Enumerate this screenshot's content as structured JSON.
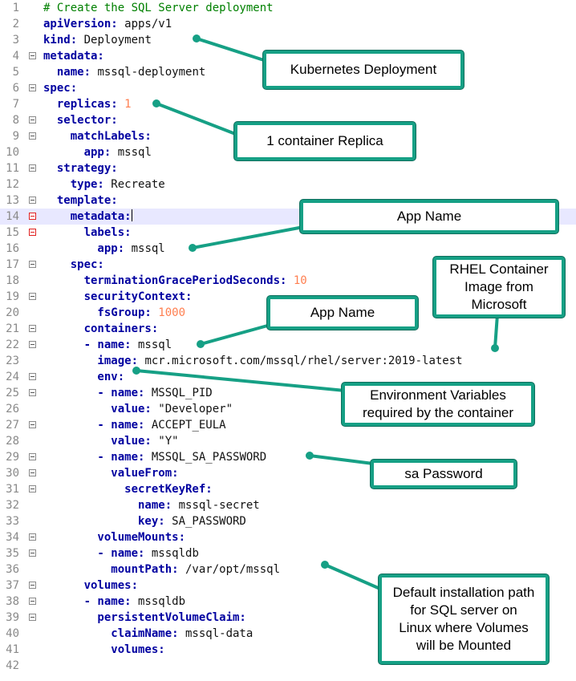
{
  "colors": {
    "keyword": "#0000a0",
    "number": "#ff7f50",
    "comment": "#008000",
    "callout_border": "#16a085"
  },
  "code_lines": [
    {
      "num": "1",
      "parts": [
        {
          "t": "# Create the SQL Server deployment",
          "c": "c"
        }
      ]
    },
    {
      "num": "2",
      "parts": [
        {
          "t": "apiVersion:",
          "c": "k"
        },
        {
          "t": " apps/v1",
          "c": "v"
        }
      ]
    },
    {
      "num": "3",
      "parts": [
        {
          "t": "kind:",
          "c": "k"
        },
        {
          "t": " Deployment",
          "c": "v"
        }
      ]
    },
    {
      "num": "4",
      "parts": [
        {
          "t": "metadata:",
          "c": "k"
        }
      ]
    },
    {
      "num": "5",
      "parts": [
        {
          "t": "  name:",
          "c": "k"
        },
        {
          "t": " mssql-deployment",
          "c": "v"
        }
      ]
    },
    {
      "num": "6",
      "parts": [
        {
          "t": "spec:",
          "c": "k"
        }
      ]
    },
    {
      "num": "7",
      "parts": [
        {
          "t": "  replicas:",
          "c": "k"
        },
        {
          "t": " ",
          "c": "v"
        },
        {
          "t": "1",
          "c": "n"
        }
      ]
    },
    {
      "num": "8",
      "parts": [
        {
          "t": "  selector:",
          "c": "k"
        }
      ]
    },
    {
      "num": "9",
      "parts": [
        {
          "t": "    matchLabels:",
          "c": "k"
        }
      ]
    },
    {
      "num": "10",
      "parts": [
        {
          "t": "      app:",
          "c": "k"
        },
        {
          "t": " mssql",
          "c": "v"
        }
      ]
    },
    {
      "num": "11",
      "parts": [
        {
          "t": "  strategy:",
          "c": "k"
        }
      ]
    },
    {
      "num": "12",
      "parts": [
        {
          "t": "    type:",
          "c": "k"
        },
        {
          "t": " Recreate",
          "c": "v"
        }
      ]
    },
    {
      "num": "13",
      "parts": [
        {
          "t": "  template:",
          "c": "k"
        }
      ]
    },
    {
      "num": "14",
      "parts": [
        {
          "t": "    metadata:",
          "c": "k"
        }
      ]
    },
    {
      "num": "15",
      "parts": [
        {
          "t": "      labels:",
          "c": "k"
        }
      ]
    },
    {
      "num": "16",
      "parts": [
        {
          "t": "        app:",
          "c": "k"
        },
        {
          "t": " mssql",
          "c": "v"
        }
      ]
    },
    {
      "num": "17",
      "parts": [
        {
          "t": "    spec:",
          "c": "k"
        }
      ]
    },
    {
      "num": "18",
      "parts": [
        {
          "t": "      terminationGracePeriodSeconds:",
          "c": "k"
        },
        {
          "t": " ",
          "c": "v"
        },
        {
          "t": "10",
          "c": "n"
        }
      ]
    },
    {
      "num": "19",
      "parts": [
        {
          "t": "      securityContext:",
          "c": "k"
        }
      ]
    },
    {
      "num": "20",
      "parts": [
        {
          "t": "        fsGroup:",
          "c": "k"
        },
        {
          "t": " ",
          "c": "v"
        },
        {
          "t": "1000",
          "c": "n"
        }
      ]
    },
    {
      "num": "21",
      "parts": [
        {
          "t": "      containers:",
          "c": "k"
        }
      ]
    },
    {
      "num": "22",
      "parts": [
        {
          "t": "      - name:",
          "c": "k"
        },
        {
          "t": " mssql",
          "c": "v"
        }
      ]
    },
    {
      "num": "23",
      "parts": [
        {
          "t": "        image:",
          "c": "k"
        },
        {
          "t": " mcr.microsoft.com/mssql/rhel/server:2019-latest",
          "c": "v"
        }
      ]
    },
    {
      "num": "24",
      "parts": [
        {
          "t": "        env:",
          "c": "k"
        }
      ]
    },
    {
      "num": "25",
      "parts": [
        {
          "t": "        - name:",
          "c": "k"
        },
        {
          "t": " MSSQL_PID",
          "c": "v"
        }
      ]
    },
    {
      "num": "26",
      "parts": [
        {
          "t": "          value:",
          "c": "k"
        },
        {
          "t": " \"Developer\"",
          "c": "v"
        }
      ]
    },
    {
      "num": "27",
      "parts": [
        {
          "t": "        - name:",
          "c": "k"
        },
        {
          "t": " ACCEPT_EULA",
          "c": "v"
        }
      ]
    },
    {
      "num": "28",
      "parts": [
        {
          "t": "          value:",
          "c": "k"
        },
        {
          "t": " \"Y\"",
          "c": "v"
        }
      ]
    },
    {
      "num": "29",
      "parts": [
        {
          "t": "        - name:",
          "c": "k"
        },
        {
          "t": " MSSQL_SA_PASSWORD",
          "c": "v"
        }
      ]
    },
    {
      "num": "30",
      "parts": [
        {
          "t": "          valueFrom:",
          "c": "k"
        }
      ]
    },
    {
      "num": "31",
      "parts": [
        {
          "t": "            secretKeyRef:",
          "c": "k"
        }
      ]
    },
    {
      "num": "32",
      "parts": [
        {
          "t": "              name:",
          "c": "k"
        },
        {
          "t": " mssql-secret",
          "c": "v"
        }
      ]
    },
    {
      "num": "33",
      "parts": [
        {
          "t": "              key:",
          "c": "k"
        },
        {
          "t": " SA_PASSWORD",
          "c": "v"
        }
      ]
    },
    {
      "num": "34",
      "parts": [
        {
          "t": "        volumeMounts:",
          "c": "k"
        }
      ]
    },
    {
      "num": "35",
      "parts": [
        {
          "t": "        - name:",
          "c": "k"
        },
        {
          "t": " mssqldb",
          "c": "v"
        }
      ]
    },
    {
      "num": "36",
      "parts": [
        {
          "t": "          mountPath:",
          "c": "k"
        },
        {
          "t": " /var/opt/mssql",
          "c": "v"
        }
      ]
    },
    {
      "num": "37",
      "parts": [
        {
          "t": "      volumes:",
          "c": "k"
        }
      ]
    },
    {
      "num": "38",
      "parts": [
        {
          "t": "      - name:",
          "c": "k"
        },
        {
          "t": " mssqldb",
          "c": "v"
        }
      ]
    },
    {
      "num": "39",
      "parts": [
        {
          "t": "        persistentVolumeClaim:",
          "c": "k"
        }
      ]
    },
    {
      "num": "40",
      "parts": [
        {
          "t": "          claimName:",
          "c": "k"
        },
        {
          "t": " mssql-data",
          "c": "v"
        }
      ]
    },
    {
      "num": "41",
      "parts": [
        {
          "t": "          volumes:",
          "c": "k"
        }
      ]
    },
    {
      "num": "42",
      "parts": []
    }
  ],
  "callouts": {
    "kubernetes_deployment": "Kubernetes Deployment",
    "container_replica": "1 container Replica",
    "app_name_1": "App Name",
    "rhel_image": "RHEL Container\nImage from\nMicrosoft",
    "app_name_2": "App Name",
    "env_vars": "Environment Variables\nrequired by the container",
    "sa_password": "sa Password",
    "install_path": "Default installation path\nfor SQL server on\nLinux where Volumes\nwill be Mounted"
  }
}
